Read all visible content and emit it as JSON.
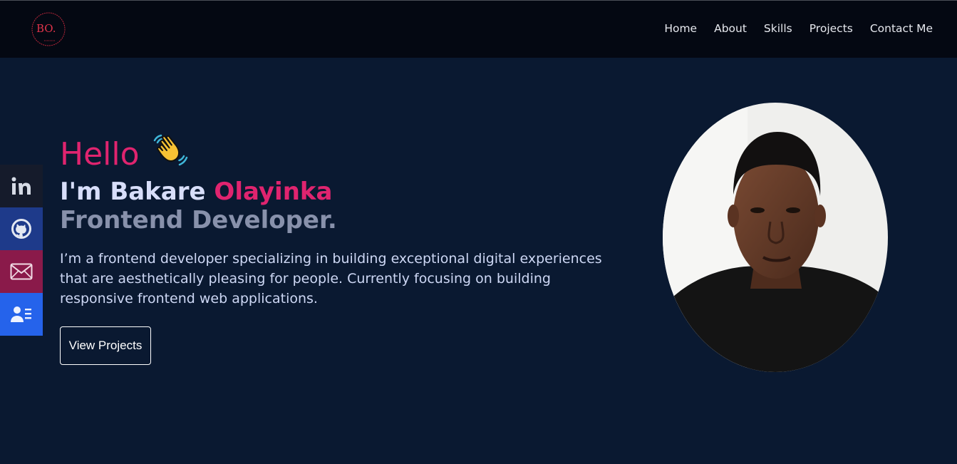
{
  "logo": {
    "text": "BO."
  },
  "nav": {
    "items": [
      {
        "label": "Home"
      },
      {
        "label": "About"
      },
      {
        "label": "Skills"
      },
      {
        "label": "Projects"
      },
      {
        "label": "Contact Me"
      }
    ]
  },
  "social": {
    "items": [
      {
        "icon": "linkedin-icon",
        "color": "#151b2b"
      },
      {
        "icon": "github-icon",
        "color": "#1e3a8a"
      },
      {
        "icon": "mail-icon",
        "color": "#8a1a4a"
      },
      {
        "icon": "contact-card-icon",
        "color": "#2563eb"
      }
    ]
  },
  "hero": {
    "greeting": "Hello",
    "intro_prefix": "I'm Bakare",
    "intro_accent": "Olayinka",
    "role": "Frontend Developer.",
    "description": "I’m a frontend developer specializing in building exceptional digital experiences that are aesthetically pleasing for people. Currently focusing on building responsive frontend web applications.",
    "cta_label": "View Projects"
  },
  "colors": {
    "background": "#0a1931",
    "topbar": "#040812",
    "accent": "#e0246f"
  }
}
